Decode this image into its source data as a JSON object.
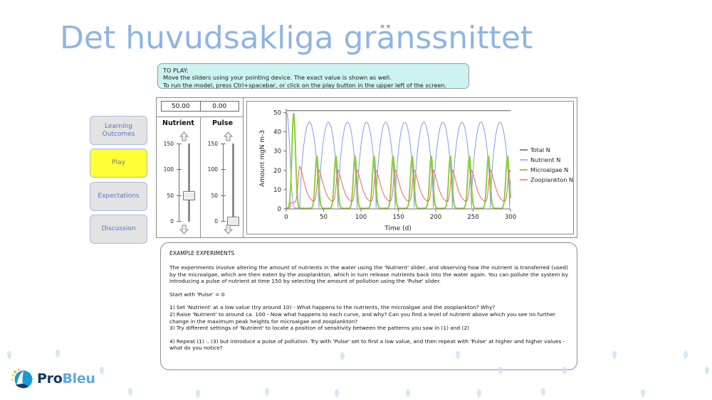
{
  "slide": {
    "title": "Det huvudsakliga gränssnittet"
  },
  "toplay": {
    "line1": "TO PLAY:",
    "line2": "Move the sliders using your pointing device. The exact value is shown as well.",
    "line3": "To run the model, press Ctrl+spacebar, or click on the play button in the upper left of the screen."
  },
  "sidebar": {
    "items": [
      {
        "label": "Learning Outcomes",
        "active": false
      },
      {
        "label": "Play",
        "active": true
      },
      {
        "label": "Expectations",
        "active": false
      },
      {
        "label": "Discussion",
        "active": false
      }
    ]
  },
  "controls": {
    "values": [
      "50.00",
      "0.00"
    ],
    "sliders": [
      {
        "name": "Nutrient",
        "value": 50,
        "min": 0,
        "max": 150,
        "ticks": [
          "150",
          "100",
          "50",
          "0"
        ],
        "up_icon": "arrow-up-icon",
        "down_icon": "arrow-down-icon"
      },
      {
        "name": "Pulse",
        "value": 0,
        "min": 0,
        "max": 150,
        "ticks": [
          "150",
          "100",
          "50",
          "0"
        ],
        "up_icon": "arrow-up-icon",
        "down_icon": "arrow-down-icon"
      }
    ]
  },
  "chart_data": {
    "type": "line",
    "title": "",
    "xlabel": "Time (d)",
    "ylabel": "Amount mgN m-3",
    "xlim": [
      0,
      300
    ],
    "ylim": [
      0,
      52
    ],
    "xticks": [
      0,
      50,
      100,
      150,
      200,
      250,
      300
    ],
    "yticks": [
      0,
      10,
      20,
      30,
      40,
      50
    ],
    "grid": false,
    "legend_position": "right",
    "series": [
      {
        "name": "Total N",
        "color": "#555555",
        "width": 1,
        "kind": "constant",
        "level": 51
      },
      {
        "name": "Nutrient N",
        "color": "#7a9fe0",
        "width": 1,
        "kind": "oscillation",
        "start_value": 50,
        "peak": 45,
        "trough": 0.5,
        "period": 25.5,
        "first_peak_x": 31,
        "phase_note": "falls from 50 at t=0 to near 0 by t=13, then oscillates"
      },
      {
        "name": "Microalgae N",
        "color": "#8fce3a",
        "width": 2,
        "kind": "spike-oscillation",
        "first_peak_value": 49.5,
        "first_peak_x": 10,
        "peak": 27.3,
        "trough": 0.3,
        "period": 25.5
      },
      {
        "name": "Zooplankton N",
        "color": "#e8646a",
        "width": 1,
        "kind": "oscillation",
        "first_peak_value": 22,
        "first_peak_x": 18,
        "peak": 20.2,
        "trough": 3.3,
        "period": 25.5
      }
    ]
  },
  "experiments": {
    "heading": "EXAMPLE EXPERIMENTS",
    "paragraph1": "The experiments involve altering the amount of nutrients in the water using the 'Nutrient' slider, and observing how the nutrient is transferred (used) by the microalgae, which are then eaten by the zooplankton, which in turn release nutrients back into the water again. You can pollute the system by introducing a pulse of nutrient at time 150 by selecting the amount of pollution using the 'Pulse' slider.",
    "paragraph2": "Start with 'Pulse' = 0",
    "item1": "1) Set 'Nutrient' at a low value (try around 10) - What happens to the nutrients, the microalgae and the zooplankton? Why?",
    "item2": "2) Raise 'Nutrient' to around ca. 100 - Now what happens to each curve, and why? Can you find a level of nutrient above which you see no further change in the maximum peak heights for microalgae and zooplankton?",
    "item3": "3) Try different settings of 'Nutrient' to locate a position of sensitivity between the patterns you saw in (1) and (2)",
    "item4": "4) Repeat (1) .. (3) but introduce a pulse of pollution. Try with 'Pulse' set to first a low value, and then repeat with 'Pulse' at higher and higher values - what do you notice?"
  },
  "footer": {
    "logo_pro": "Pro",
    "logo_bleu": "Bleu",
    "logo_icon": "probleu-wave-logo"
  },
  "colors": {
    "title": "#8fb4e3",
    "toplay_bg": "#cdf2f2",
    "active_button": "#ffff33",
    "button_border": "#a8bce0",
    "button_text": "#5577bb"
  }
}
